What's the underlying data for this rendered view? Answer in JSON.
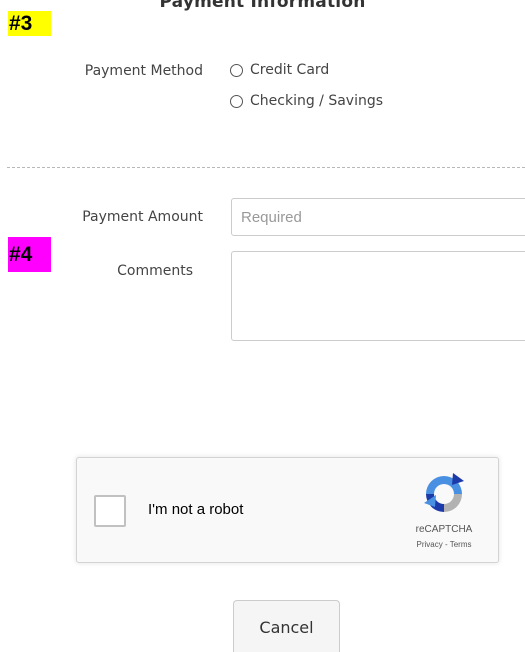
{
  "section": {
    "title": "Payment Information"
  },
  "tags": {
    "tag3": "#3",
    "tag4": "#4"
  },
  "payment_method": {
    "label": "Payment Method",
    "options": [
      {
        "label": "Credit Card",
        "selected": false
      },
      {
        "label": "Checking / Savings",
        "selected": false
      }
    ]
  },
  "payment_amount": {
    "label": "Payment Amount",
    "value": "",
    "placeholder": "Required"
  },
  "comments": {
    "label": "Comments",
    "value": ""
  },
  "recaptcha": {
    "checkbox_label": "I'm not a robot",
    "brand": "reCAPTCHA",
    "privacy_link": "Privacy",
    "separator": " - ",
    "terms_link": "Terms",
    "logo_icon": "recaptcha-logo-icon",
    "colors": {
      "blue": "#4a90e2",
      "dark_blue": "#1c3aa9",
      "gray": "#b2b2b2"
    }
  },
  "actions": {
    "cancel_label": "Cancel"
  }
}
